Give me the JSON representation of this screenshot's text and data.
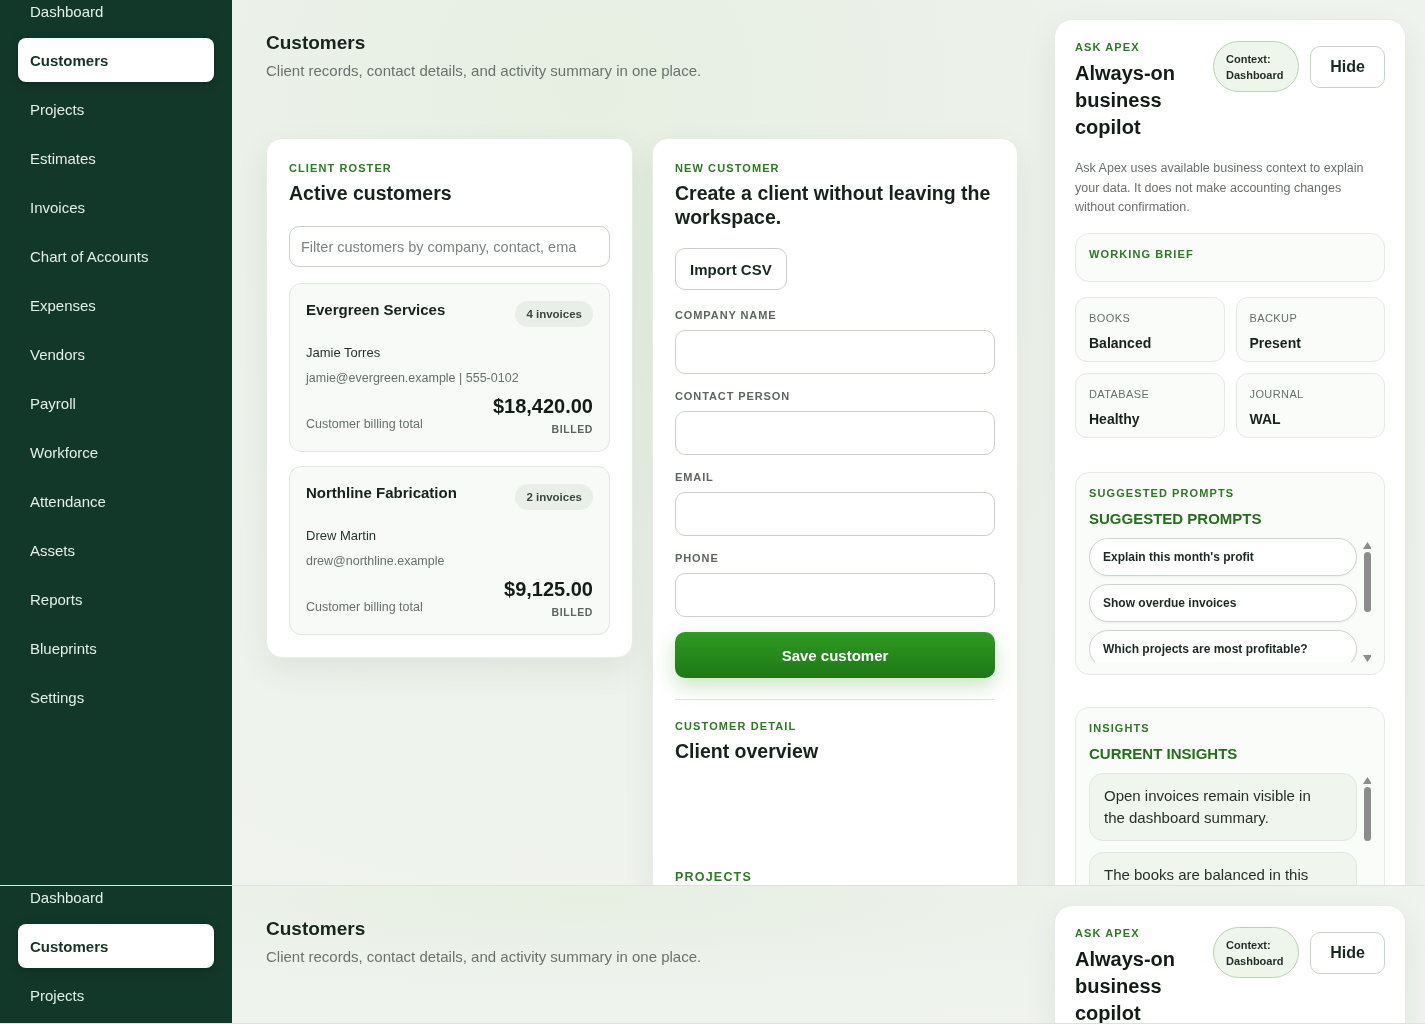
{
  "views": [
    {
      "sidebar": {
        "items": [
          {
            "label": "Dashboard",
            "selected": false
          },
          {
            "label": "Customers",
            "selected": true
          },
          {
            "label": "Projects",
            "selected": false
          },
          {
            "label": "Estimates",
            "selected": false
          },
          {
            "label": "Invoices",
            "selected": false
          },
          {
            "label": "Chart of Accounts",
            "selected": false
          },
          {
            "label": "Expenses",
            "selected": false
          },
          {
            "label": "Vendors",
            "selected": false
          },
          {
            "label": "Payroll",
            "selected": false
          },
          {
            "label": "Workforce",
            "selected": false
          },
          {
            "label": "Attendance",
            "selected": false
          },
          {
            "label": "Assets",
            "selected": false
          },
          {
            "label": "Reports",
            "selected": false
          },
          {
            "label": "Blueprints",
            "selected": false
          },
          {
            "label": "Settings",
            "selected": false
          }
        ]
      },
      "header": {
        "title": "Customers",
        "subtitle": "Client records, contact details, and activity summary in one place."
      },
      "roster": {
        "eyebrow": "CLIENT ROSTER",
        "title": "Active customers",
        "filter": {
          "placeholder": "Filter customers by company, contact, ema"
        },
        "customers": [
          {
            "company": "Evergreen Services",
            "invoices": "4 invoices",
            "contact": "Jamie Torres",
            "details": "jamie@evergreen.example | 555-0102",
            "total_label": "Customer billing total",
            "amount": "$18,420.00",
            "status": "BILLED"
          },
          {
            "company": "Northline Fabrication",
            "invoices": "2 invoices",
            "contact": "Drew Martin",
            "details": "drew@northline.example",
            "total_label": "Customer billing total",
            "amount": "$9,125.00",
            "status": "BILLED"
          }
        ]
      },
      "new_customer": {
        "eyebrow": "NEW CUSTOMER",
        "title": "Create a client without leaving the workspace.",
        "import_button": "Import CSV",
        "fields": [
          {
            "label": "COMPANY NAME"
          },
          {
            "label": "CONTACT PERSON"
          },
          {
            "label": "EMAIL"
          },
          {
            "label": "PHONE"
          }
        ],
        "submit": "Save customer",
        "detail": {
          "eyebrow": "CUSTOMER DETAIL",
          "title": "Client overview",
          "section": "PROJECTS"
        }
      },
      "assistant": {
        "eyebrow": "ASK APEX",
        "title": "Always-on business copilot",
        "context": "Context: Dashboard",
        "hide_button": "Hide",
        "description": "Ask Apex uses available business context to explain your data. It does not make accounting changes without confirmation.",
        "brief": {
          "eyebrow": "WORKING BRIEF"
        },
        "stats": [
          {
            "label": "BOOKS",
            "value": "Balanced"
          },
          {
            "label": "BACKUP",
            "value": "Present"
          },
          {
            "label": "DATABASE",
            "value": "Healthy"
          },
          {
            "label": "JOURNAL",
            "value": "WAL"
          }
        ],
        "prompts": {
          "eyebrow": "SUGGESTED PROMPTS",
          "title": "SUGGESTED PROMPTS",
          "items": [
            "Explain this month's profit",
            "Show overdue invoices",
            "Which projects are most profitable?"
          ]
        },
        "insights": {
          "eyebrow": "INSIGHTS",
          "title": "CURRENT INSIGHTS",
          "items": [
            "Open invoices remain visible in the dashboard summary.",
            "The books are balanced in this"
          ]
        }
      }
    },
    {
      "sidebar": {
        "items": [
          {
            "label": "Dashboard",
            "selected": false
          },
          {
            "label": "Customers",
            "selected": true
          },
          {
            "label": "Projects",
            "selected": false
          }
        ]
      },
      "header": {
        "title": "Customers",
        "subtitle": "Client records, contact details, and activity summary in one place."
      },
      "assistant": {
        "eyebrow": "ASK APEX",
        "title": "Always-on business copilot",
        "context": "Context: Dashboard",
        "hide_button": "Hide"
      }
    }
  ]
}
